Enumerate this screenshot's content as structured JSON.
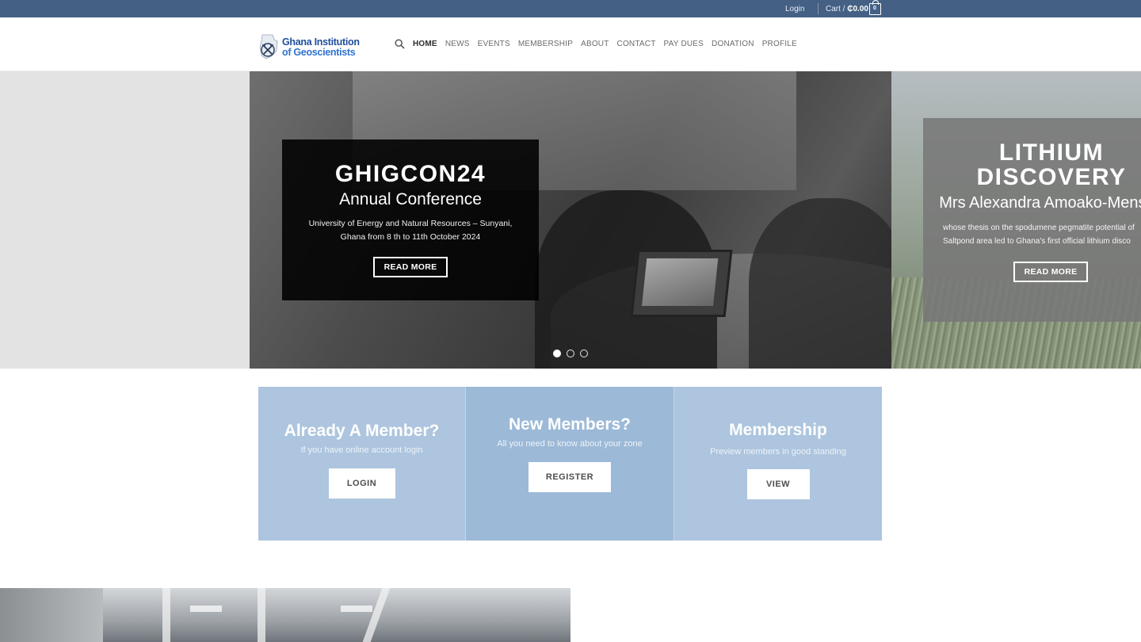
{
  "topbar": {
    "login": "Login",
    "cart_label": "Cart /",
    "cart_amount": "₵0.00",
    "cart_count": "0"
  },
  "header": {
    "logo_line1": "Ghana Institution",
    "logo_line2": "of Geoscientists",
    "nav": [
      "HOME",
      "NEWS",
      "EVENTS",
      "MEMBERSHIP",
      "ABOUT",
      "CONTACT",
      "PAY DUES",
      "DONATION",
      "PROFILE"
    ],
    "active_nav": "HOME"
  },
  "slider": {
    "current": {
      "title": "GHIGCON24",
      "subtitle": "Annual Conference",
      "text": "University of Energy and Natural Resources – Sunyani, Ghana from 8 th to 11th October 2024",
      "button": "READ MORE"
    },
    "next": {
      "title": "LITHIUM DISCOVERY",
      "subtitle": "Mrs Alexandra Amoako-Mensah",
      "text_line1": "whose thesis on the spodumene pegmatite potential of",
      "text_line2": "Saltpond area led to Ghana's first official lithium disco",
      "button": "READ MORE"
    },
    "dot_count": 3,
    "active_dot": 0
  },
  "members": {
    "existing": {
      "title": "Already A Member?",
      "text": "If you have online account login",
      "button": "LOGIN"
    },
    "new": {
      "title": "New Members?",
      "text": "All you need to know about your zone",
      "button": "REGISTER"
    },
    "list": {
      "title": "Membership",
      "text": "Preview members in good standing",
      "button": "VIEW"
    }
  },
  "colors": {
    "topbar": "#446084",
    "box_light": "#adc5de",
    "box_mid": "#9cb9d7",
    "logo_blue": "#1f4e9c"
  },
  "icons": [
    "search-icon",
    "cart-bag-icon",
    "logo-emblem-icon"
  ]
}
